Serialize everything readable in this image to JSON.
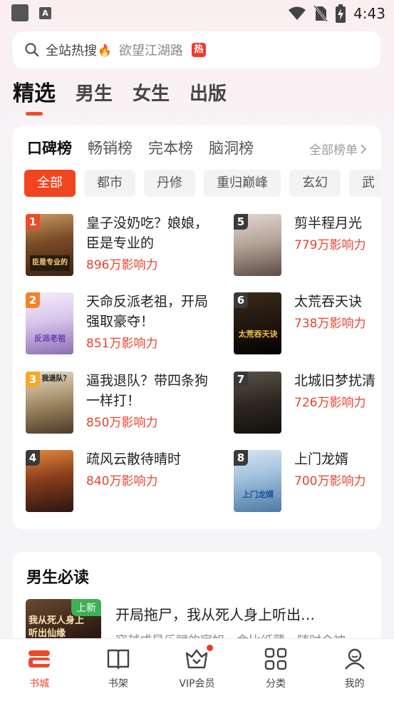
{
  "status_bar": {
    "time": "4:43"
  },
  "search": {
    "hot_label": "全站热搜",
    "suggestion": "欲望江湖路",
    "hot_badge": "热"
  },
  "main_tabs": [
    {
      "label": "精选",
      "active": true
    },
    {
      "label": "男生"
    },
    {
      "label": "女生"
    },
    {
      "label": "出版"
    }
  ],
  "rankings": {
    "tabs": [
      "口碑榜",
      "畅销榜",
      "完本榜",
      "脑洞榜"
    ],
    "all_label": "全部榜单",
    "chips": [
      "全部",
      "都市",
      "丹修",
      "重归巅峰",
      "玄幻",
      "武"
    ],
    "books": [
      {
        "rank": "1",
        "title": "皇子没奶吃？娘娘，臣是专业的",
        "influence": "896万影响力",
        "cover_text": "臣是专业的"
      },
      {
        "rank": "2",
        "title": "天命反派老祖，开局强取豪夺！",
        "influence": "851万影响力",
        "cover_text": "反派老祖"
      },
      {
        "rank": "3",
        "title": "逼我退队？带四条狗一样打！",
        "influence": "850万影响力",
        "cover_text": "我退队？"
      },
      {
        "rank": "4",
        "title": "疏风云散待晴时",
        "influence": "840万影响力",
        "cover_text": ""
      },
      {
        "rank": "5",
        "title": "剪半程月光",
        "influence": "779万影响力",
        "cover_text": ""
      },
      {
        "rank": "6",
        "title": "太荒吞天诀",
        "influence": "738万影响力",
        "cover_text": "太荒吞天诀"
      },
      {
        "rank": "7",
        "title": "北城旧梦扰清",
        "influence": "726万影响力",
        "cover_text": ""
      },
      {
        "rank": "8",
        "title": "上门龙婿",
        "influence": "700万影响力",
        "cover_text": "上门龙婿"
      }
    ]
  },
  "must_read": {
    "title": "男生必读",
    "book_title": "开局拖尸，我从死人身上听出…",
    "book_desc": "容越成是乐赋的宦奴，命比纸薄，随时会被",
    "badge": "上新",
    "cover_text": "我从死人身上听出仙缘"
  },
  "bottom_nav": [
    {
      "label": "书城",
      "icon": "bookstore-icon",
      "active": true
    },
    {
      "label": "书架",
      "icon": "bookshelf-icon"
    },
    {
      "label": "VIP会员",
      "icon": "vip-crown-icon"
    },
    {
      "label": "分类",
      "icon": "category-grid-icon"
    },
    {
      "label": "我的",
      "icon": "profile-icon"
    }
  ],
  "colors": {
    "accent": "#f0451f",
    "influence": "#e8452d"
  }
}
